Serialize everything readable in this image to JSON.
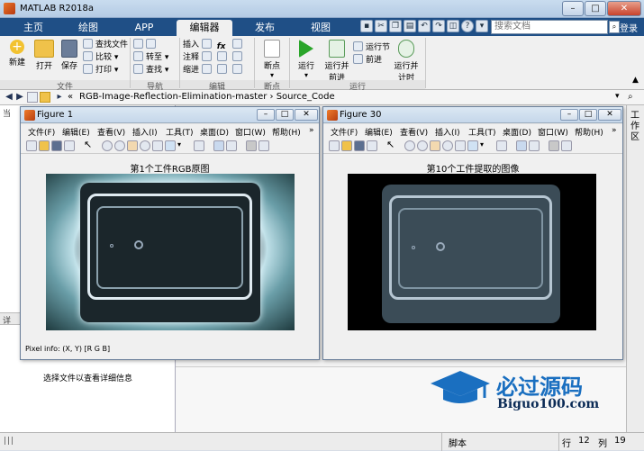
{
  "window": {
    "title": "MATLAB R2018a"
  },
  "tabs": [
    {
      "label": "主页"
    },
    {
      "label": "绘图"
    },
    {
      "label": "APP"
    },
    {
      "label": "编辑器"
    },
    {
      "label": "发布"
    },
    {
      "label": "视图"
    }
  ],
  "search": {
    "placeholder": "搜索文档",
    "login": "登录"
  },
  "ribbon": {
    "file": {
      "new": "新建",
      "open": "打开",
      "save": "保存",
      "find_files": "查找文件",
      "compare": "比较",
      "print": "打印",
      "group": "文件"
    },
    "nav": {
      "goto": "转至",
      "find": "查找",
      "group": "导航"
    },
    "edit": {
      "insert": "插入",
      "comment": "注释",
      "indent": "缩进",
      "fx": "fx",
      "group": "编辑"
    },
    "breakpoints": {
      "label": "断点",
      "group": "断点"
    },
    "run": {
      "run": "运行",
      "run_advance": "运行并前进",
      "run_section": "运行节",
      "advance": "前进",
      "run_time": "运行并计时",
      "group": "运行"
    }
  },
  "address": {
    "path": "RGB-Image-Reflection-Elimination-master  ›  Source_Code"
  },
  "left_pane": {
    "detail_hint": "选择文件以查看详细信息",
    "side_label_top": "当",
    "side_label_mid": "详"
  },
  "workspace_tab": "工作区",
  "fig1": {
    "title": "Figure 1",
    "caption": "第1个工件RGB原图",
    "pixel_info": "Pixel info: (X, Y)  [R G B]"
  },
  "fig30": {
    "title": "Figure 30",
    "caption": "第10个工件提取的图像"
  },
  "fig_menu": [
    "文件(F)",
    "编辑(E)",
    "查看(V)",
    "插入(I)",
    "工具(T)",
    "桌面(D)",
    "窗口(W)",
    "帮助(H)"
  ],
  "status": {
    "script": "脚本",
    "row_label": "行",
    "row": "12",
    "col_label": "列",
    "col": "19"
  },
  "watermark": {
    "cn": "必过源码",
    "en": "Biguo100.com"
  }
}
